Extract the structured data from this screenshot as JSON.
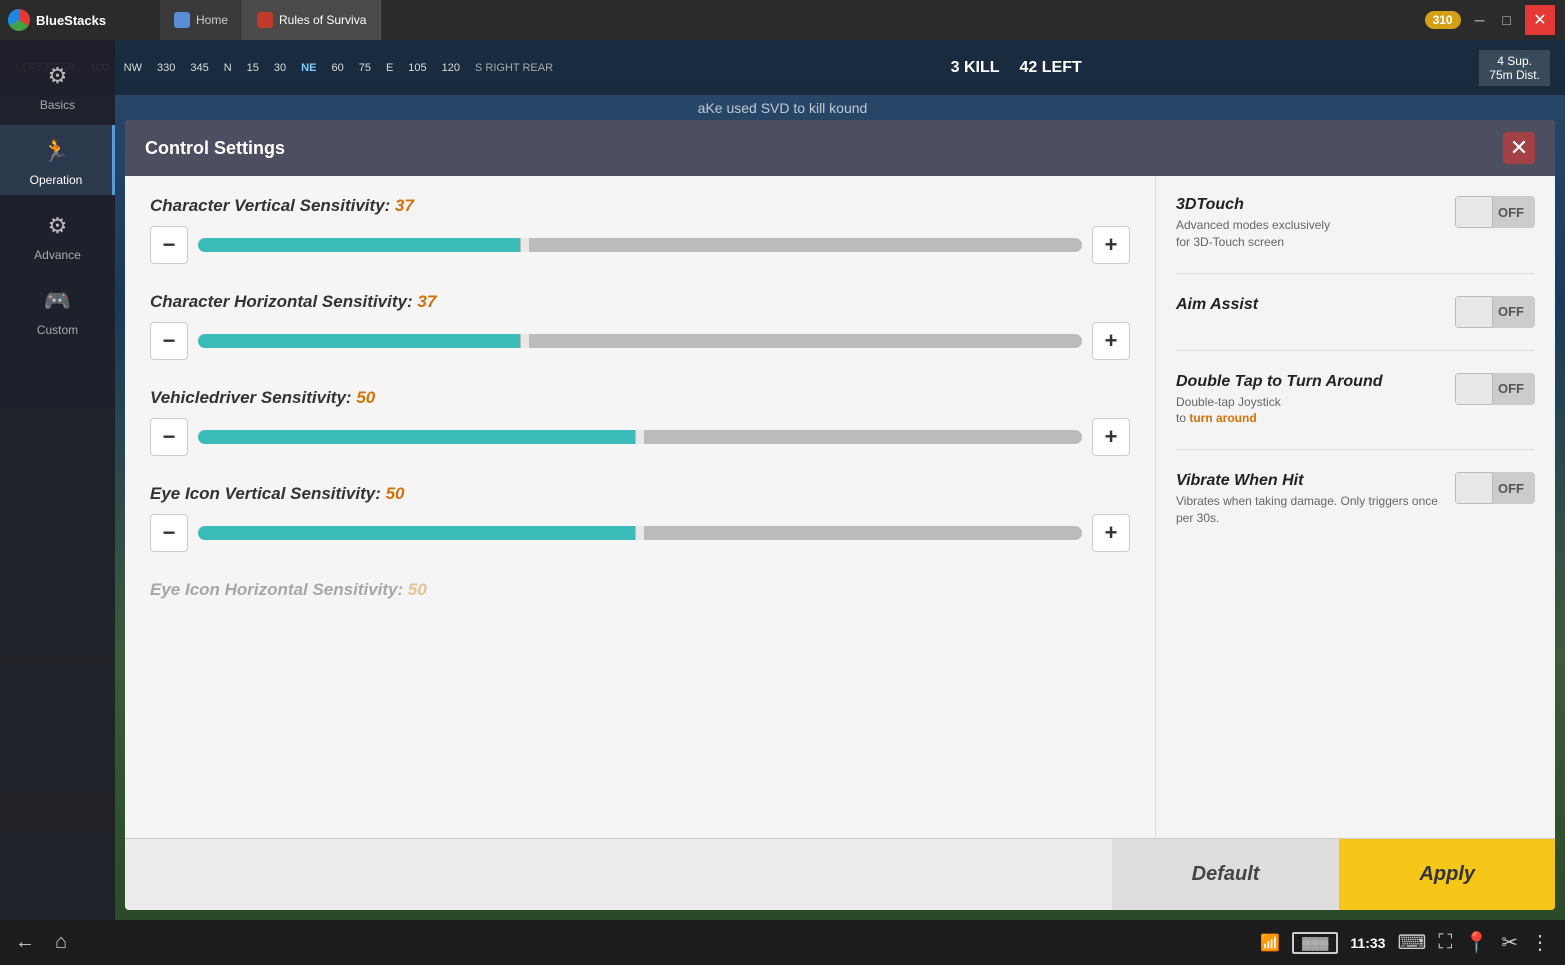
{
  "titleBar": {
    "appName": "BlueStacks",
    "tabs": [
      {
        "label": "Home",
        "type": "home"
      },
      {
        "label": "Rules of Surviva",
        "type": "game"
      }
    ],
    "coinCount": "310",
    "windowButtons": [
      "minimize",
      "maximize",
      "close"
    ]
  },
  "gameHud": {
    "compassItems": [
      "LEFT REAR",
      "100",
      "NW",
      "330",
      "345",
      "N",
      "15",
      "30",
      "NE",
      "60",
      "75",
      "E",
      "105",
      "120",
      "S RIGHT REAR"
    ],
    "killCount": "3 KILL",
    "leftCount": "42 LEFT",
    "supInfo": "4 Sup.\n75m Dist.",
    "killMessage": "aKe used SVD to kill kound"
  },
  "sidebar": {
    "items": [
      {
        "label": "Basics",
        "icon": "⚙"
      },
      {
        "label": "Operation",
        "icon": "🏃",
        "active": true
      },
      {
        "label": "Advance",
        "icon": "⚙"
      },
      {
        "label": "Custom",
        "icon": "🎮"
      }
    ]
  },
  "controlSettings": {
    "title": "Control Settings",
    "closeButton": "✕",
    "settings": [
      {
        "label": "Character Vertical Sensitivity:",
        "value": "37",
        "sliderPercent": 37
      },
      {
        "label": "Character Horizontal Sensitivity:",
        "value": "37",
        "sliderPercent": 37
      },
      {
        "label": "Vehicledriver Sensitivity:",
        "value": "50",
        "sliderPercent": 50
      },
      {
        "label": "Eye Icon Vertical Sensitivity:",
        "value": "50",
        "sliderPercent": 50
      }
    ],
    "toggles": [
      {
        "title": "3DTouch",
        "desc": "Advanced modes exclusively\nfor 3D-Touch screen",
        "state": "OFF"
      },
      {
        "title": "Aim Assist",
        "desc": "",
        "state": "OFF"
      },
      {
        "title": "Double Tap to Turn Around",
        "desc": "Double-tap Joystick\nto turn around",
        "descHighlight": "turn around",
        "state": "OFF"
      },
      {
        "title": "Vibrate When Hit",
        "desc": "Vibrates when taking damage. Only triggers once per 30s.",
        "state": "OFF"
      }
    ],
    "footer": {
      "defaultLabel": "Default",
      "applyLabel": "Apply"
    }
  },
  "taskbar": {
    "time": "11:33"
  }
}
